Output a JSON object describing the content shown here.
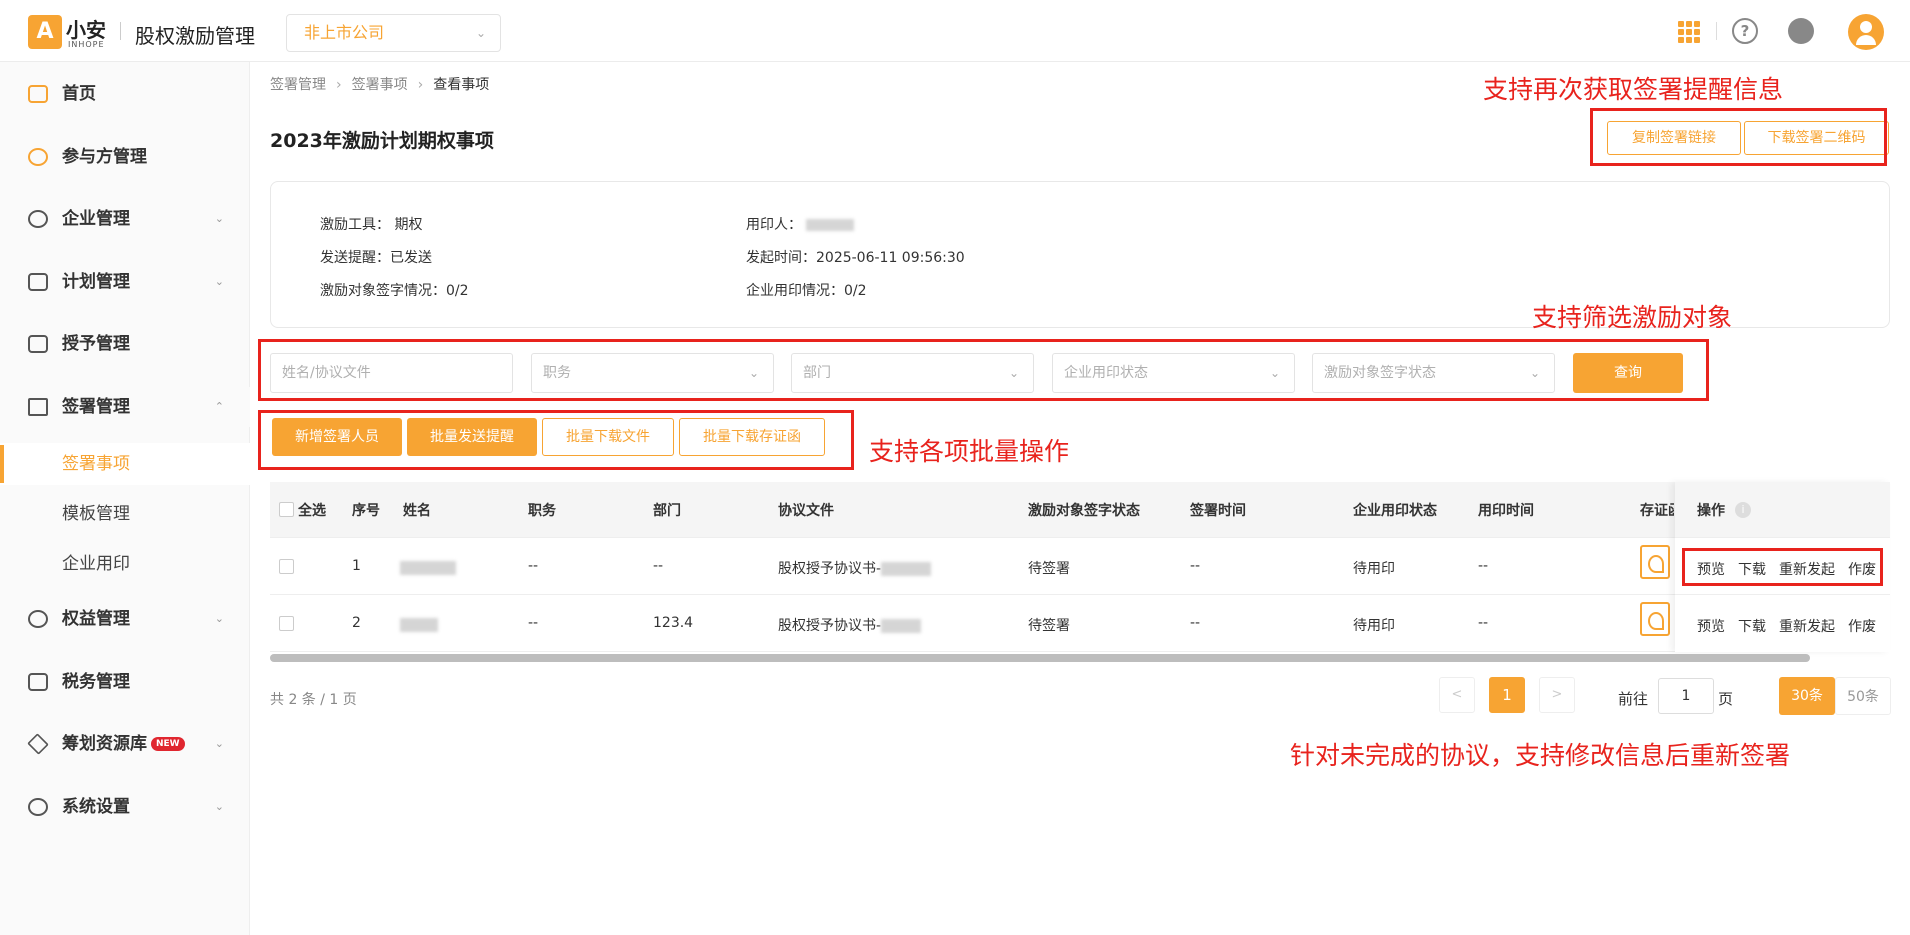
{
  "app": {
    "logo_glyph": "A",
    "logo_name": "小安",
    "logo_sub": "INHOPE",
    "title": "股权激励管理",
    "company_select": "非上市公司"
  },
  "header_icons": [
    "apps-grid-icon",
    "help-icon",
    "customer-service-icon",
    "user-avatar-icon"
  ],
  "sidebar": {
    "items": [
      {
        "label": "首页",
        "icon": "home-icon"
      },
      {
        "label": "参与方管理",
        "icon": "users-icon"
      },
      {
        "label": "企业管理",
        "icon": "enterprise-icon"
      },
      {
        "label": "计划管理",
        "icon": "plan-icon"
      },
      {
        "label": "授予管理",
        "icon": "grant-icon"
      },
      {
        "label": "签署管理",
        "icon": "sign-icon",
        "expanded": true
      },
      {
        "label": "权益管理",
        "icon": "equity-icon"
      },
      {
        "label": "税务管理",
        "icon": "tax-icon"
      },
      {
        "label": "筹划资源库",
        "icon": "layers-icon",
        "badge": "NEW"
      },
      {
        "label": "系统设置",
        "icon": "settings-icon"
      }
    ],
    "sub_items": [
      {
        "label": "签署事项",
        "active": true
      },
      {
        "label": "模板管理"
      },
      {
        "label": "企业用印"
      }
    ]
  },
  "breadcrumb": [
    "签署管理",
    "签署事项",
    "查看事项"
  ],
  "page_title": "2023年激励计划期权事项",
  "top_actions": {
    "copy_link": "复制签署链接",
    "download_qr": "下载签署二维码"
  },
  "info": {
    "tool_label": "激励工具：",
    "tool_value": "期权",
    "reminder_label": "发送提醒：",
    "reminder_value": "已发送",
    "sign_label": "激励对象签字情况：",
    "sign_value": "0/2",
    "sealer_label": "用印人：",
    "start_label": "发起时间：",
    "start_value": "2025-06-11 09:56:30",
    "seal_label": "企业用印情况：",
    "seal_value": "0/2"
  },
  "filters": {
    "name_placeholder": "姓名/协议文件",
    "position": "职务",
    "department": "部门",
    "seal_status": "企业用印状态",
    "sign_status": "激励对象签字状态",
    "query": "查询"
  },
  "batch": {
    "add": "新增签署人员",
    "remind": "批量发送提醒",
    "download_files": "批量下载文件",
    "download_certs": "批量下载存证函"
  },
  "annotations": {
    "top": "支持再次获取签署提醒信息",
    "filter": "支持筛选激励对象",
    "batch": "支持各项批量操作",
    "bottom": "针对未完成的协议，支持修改信息后重新签署"
  },
  "table": {
    "headers": {
      "select_all": "全选",
      "index": "序号",
      "name": "姓名",
      "position": "职务",
      "department": "部门",
      "file": "协议文件",
      "sign_status": "激励对象签字状态",
      "sign_time": "签署时间",
      "seal_status": "企业用印状态",
      "seal_time": "用印时间",
      "cert": "存证函",
      "ops": "操作"
    },
    "rows": [
      {
        "index": "1",
        "position": "--",
        "department": "--",
        "file": "股权授予协议书-",
        "sign_status": "待签署",
        "sign_time": "--",
        "seal_status": "待用印",
        "seal_time": "--"
      },
      {
        "index": "2",
        "position": "--",
        "department": "123.4",
        "file": "股权授予协议书-",
        "sign_status": "待签署",
        "sign_time": "--",
        "seal_status": "待用印",
        "seal_time": "--"
      }
    ],
    "ops": {
      "preview": "预览",
      "download": "下载",
      "resend": "重新发起",
      "void": "作废"
    }
  },
  "pagination": {
    "total": "共 2 条 / 1 页",
    "prev": "<",
    "current": "1",
    "next": ">",
    "goto": "前往",
    "page_input": "1",
    "page_unit": "页",
    "size30": "30条",
    "size50": "50条"
  },
  "colors": {
    "accent": "#f7a433",
    "annotation": "#e8231d"
  }
}
